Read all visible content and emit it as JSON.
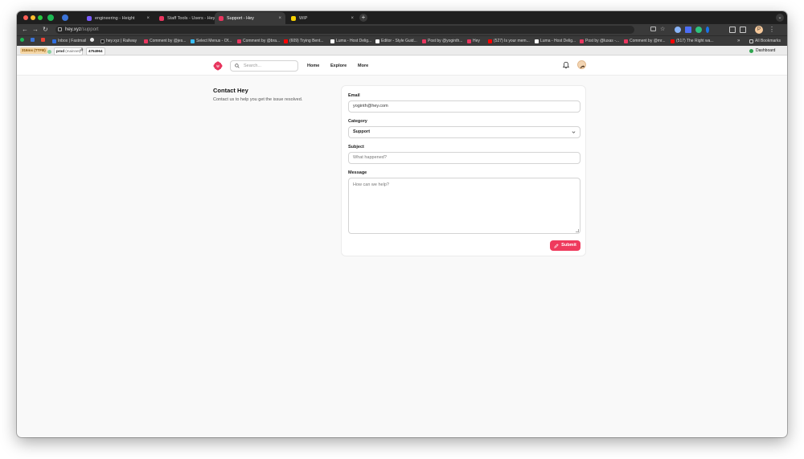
{
  "browser": {
    "tabs": [
      {
        "label": "engineering - Height",
        "active": false
      },
      {
        "label": "Staff Tools - Users - Hey",
        "active": false
      },
      {
        "label": "Support - Hey",
        "active": true
      },
      {
        "label": "WIP",
        "active": false
      }
    ],
    "url_host": "hey.xyz",
    "url_path": "/support",
    "bookmarks": [
      "Inbox | Fastmail",
      "hey.xyz | Railway",
      "Comment by @jes...",
      "Select Menus - Of...",
      "Comment by @bra...",
      "(609) Trying Bent...",
      "Luma - Host Delig...",
      "Editor - Style Guid...",
      "Post by @yoginth...",
      "Hey",
      "(527) Is your mem...",
      "Luma - Host Delig...",
      "Post by @luxas -...",
      "Comment by @mr...",
      "(517) The Right wa..."
    ],
    "all_bookmarks": "All Bookmarks",
    "profile_initial": "P"
  },
  "devbar": {
    "latency": "316ms (TTFB)",
    "branch": "prod",
    "branch_suffix": "(mainnet)",
    "commit_hash_icon": "#",
    "commit": "4754964",
    "dashboard": "Dashboard"
  },
  "nav": {
    "search_placeholder": "Search...",
    "links": [
      "Home",
      "Explore",
      "More"
    ]
  },
  "page": {
    "title": "Contact Hey",
    "subtitle": "Contact us to help you get the issue resolved."
  },
  "form": {
    "email_label": "Email",
    "email_value": "yoginth@hey.com",
    "category_label": "Category",
    "category_value": "Support",
    "subject_label": "Subject",
    "subject_placeholder": "What happened?",
    "message_label": "Message",
    "message_placeholder": "How can we help?",
    "submit_label": "Submit"
  },
  "colors": {
    "accent": "#ef3a5d",
    "brand_logo": "#e8365f"
  }
}
